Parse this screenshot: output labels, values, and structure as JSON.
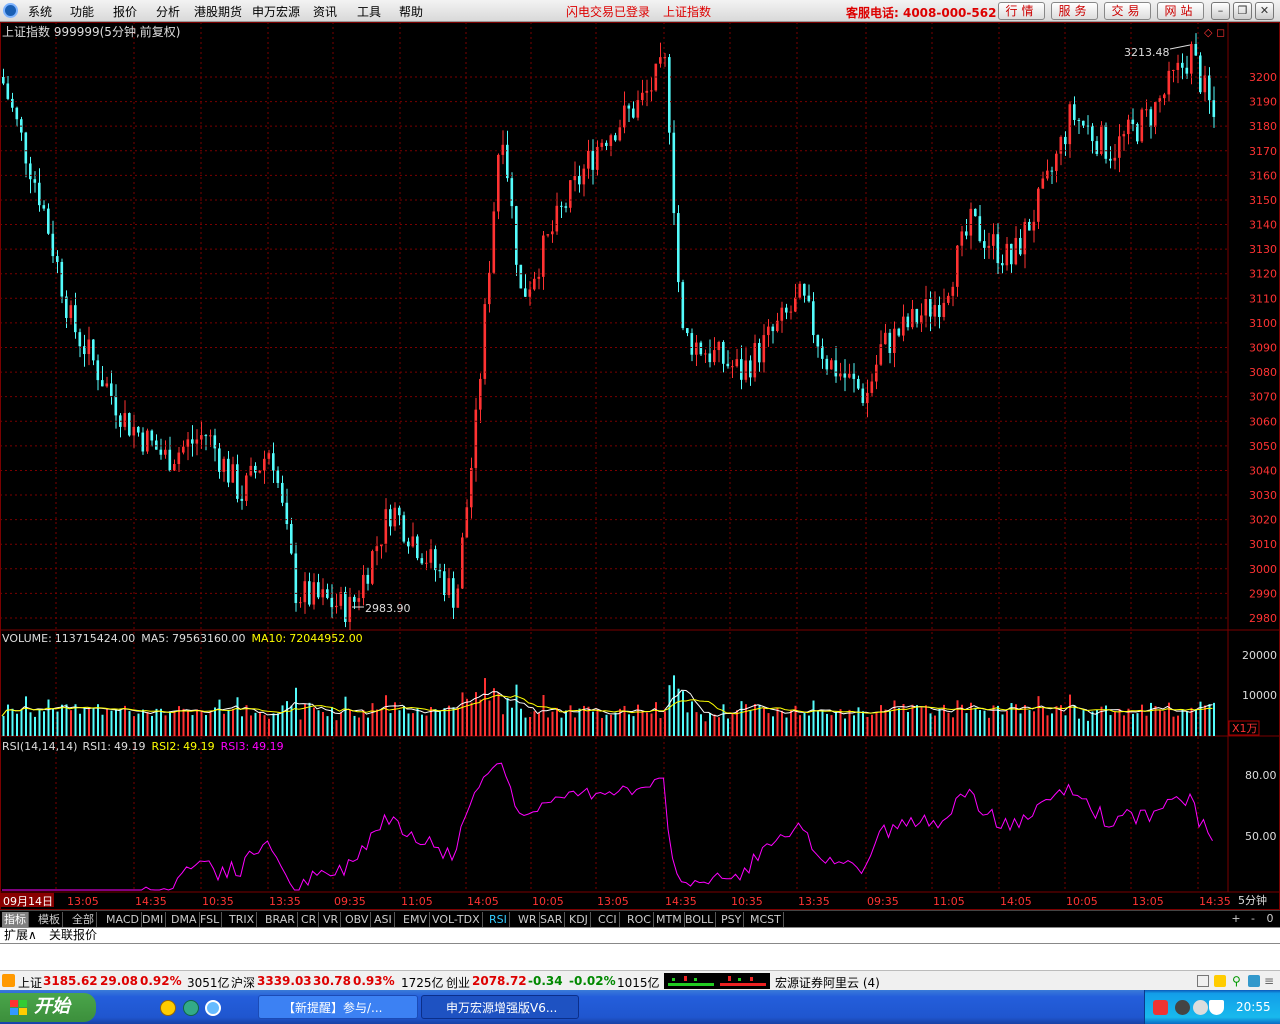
{
  "menubar": {
    "items": [
      "系统",
      "功能",
      "报价",
      "分析",
      "港股期货",
      "申万宏源",
      "资讯",
      "工具",
      "帮助"
    ],
    "status": [
      "闪电交易已登录",
      "上证指数"
    ],
    "hotline": "客服电话: 4008-000-562",
    "quick_buttons": [
      "行情",
      "服务",
      "交易",
      "网站"
    ]
  },
  "chart_header": {
    "title": "上证指数 999999(5分钟,前复权)"
  },
  "price_chart": {
    "ylim": [
      2975,
      3215
    ],
    "ticks": [
      "3200",
      "3190",
      "3180",
      "3170",
      "3160",
      "3150",
      "3140",
      "3130",
      "3120",
      "3110",
      "3100",
      "3090",
      "3080",
      "3070",
      "3060",
      "3050",
      "3040",
      "3030",
      "3020",
      "3010",
      "3000",
      "2990",
      "2980"
    ],
    "high_label": "3213.48",
    "low_label": "2983.90"
  },
  "volume": {
    "label": "VOLUME:",
    "value": "113715424.00",
    "ma5_label": "MA5:",
    "ma5": "79563160.00",
    "ma10_label": "MA10:",
    "ma10": "72044952.00",
    "ticks": [
      "20000",
      "10000"
    ],
    "unit": "X1万"
  },
  "rsi": {
    "label": "RSI(14,14,14)",
    "rsi1_label": "RSI1:",
    "rsi1": "49.19",
    "rsi2_label": "RSI2:",
    "rsi2": "49.19",
    "rsi3_label": "RSI3:",
    "rsi3": "49.19",
    "ticks": [
      "80.00",
      "50.00"
    ]
  },
  "time_axis": {
    "labels": [
      "09月14日",
      "13:05",
      "14:35",
      "10:35",
      "13:35",
      "09:35",
      "11:05",
      "14:05",
      "10:05",
      "13:05",
      "14:35",
      "10:35",
      "13:35",
      "09:35",
      "11:05",
      "14:05",
      "10:05",
      "13:05",
      "14:35"
    ],
    "period": "5分钟"
  },
  "tabs": [
    "指标",
    "模板",
    "全部",
    "MACD",
    "DMI",
    "DMA",
    "FSL",
    "TRIX",
    "BRAR",
    "CR",
    "VR",
    "OBV",
    "ASI",
    "EMV",
    "VOL-TDX",
    "RSI",
    "WR",
    "SAR",
    "KDJ",
    "CCI",
    "ROC",
    "MTM",
    "BOLL",
    "PSY",
    "MCST"
  ],
  "tab_controls": [
    "+",
    "-",
    "0"
  ],
  "expand": [
    "扩展∧",
    "关联报价"
  ],
  "indices": {
    "sh_name": "上证",
    "sh": "3185.62",
    "sh_chg": "29.08",
    "sh_pct": "0.92%",
    "sh_amt": "3051亿",
    "hs_name": "沪深",
    "hs": "3339.03",
    "hs_chg": "30.78",
    "hs_pct": "0.93%",
    "hs_amt": "1725亿",
    "cy_name": "创业",
    "cy": "2078.72",
    "cy_chg": "-0.34",
    "cy_pct": "-0.02%",
    "cy_amt": "1015亿",
    "server": "宏源证券阿里云 (4)"
  },
  "taskbar": {
    "start": "开始",
    "tasks": [
      "【新提醒】参与/...",
      "申万宏源增强版V6..."
    ],
    "clock": "20:55"
  },
  "colors": {
    "up": "#ff3232",
    "down": "#54fcfc",
    "ma5": "#ffffff",
    "ma10": "#ffff00",
    "rsi": "#ff00ff",
    "grid": "#7a0000"
  }
}
